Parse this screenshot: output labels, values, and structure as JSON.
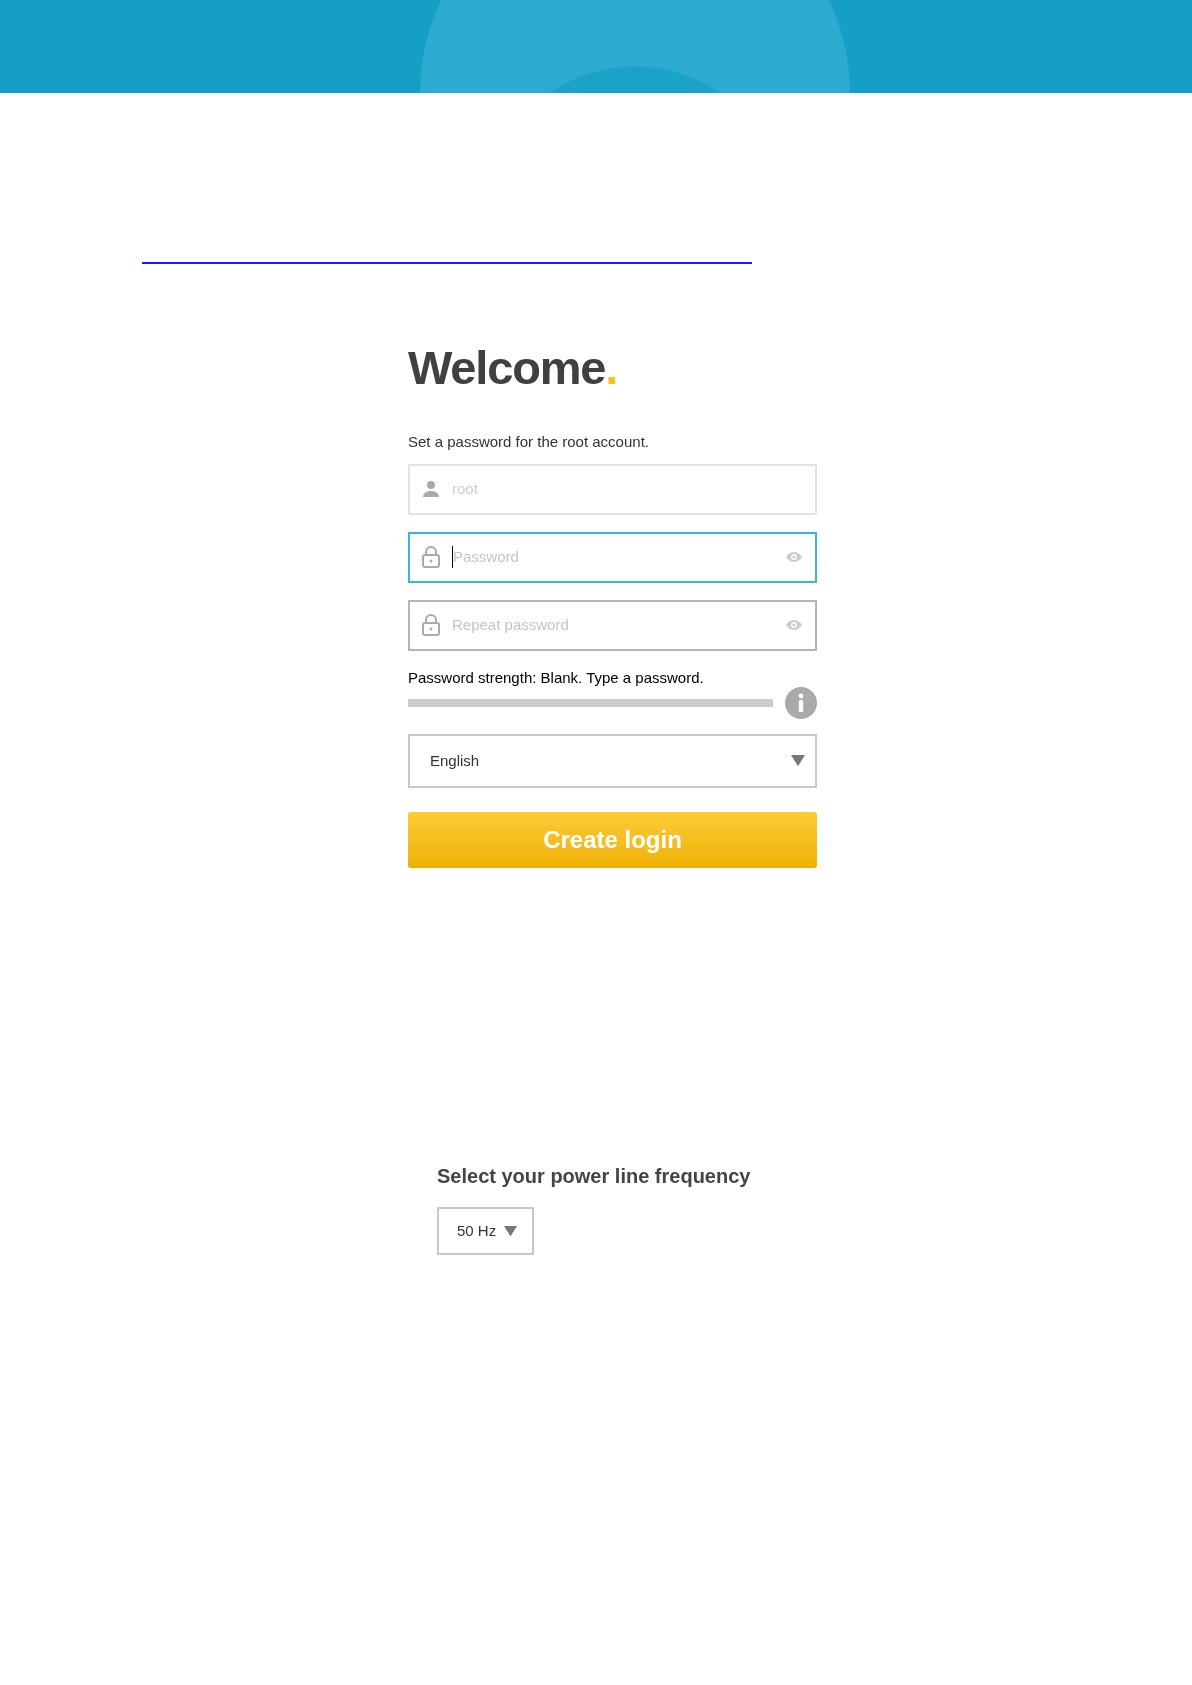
{
  "welcome": {
    "title": "Welcome",
    "title_mark": ".",
    "instruction": "Set a password for the root account."
  },
  "fields": [
    {
      "kind": "user",
      "placeholder": "root",
      "disabled": true,
      "focused": false,
      "reveal": false
    },
    {
      "kind": "lock",
      "placeholder": "Password",
      "disabled": false,
      "focused": true,
      "reveal": true
    },
    {
      "kind": "lock",
      "placeholder": "Repeat password",
      "disabled": false,
      "focused": false,
      "reveal": true
    }
  ],
  "strength": {
    "text": "Password strength: Blank. Type a password.",
    "level": 0
  },
  "language": {
    "value": "English"
  },
  "create_button": "Create login",
  "power_line": {
    "title": "Select your power line frequency",
    "value": "50 Hz"
  }
}
